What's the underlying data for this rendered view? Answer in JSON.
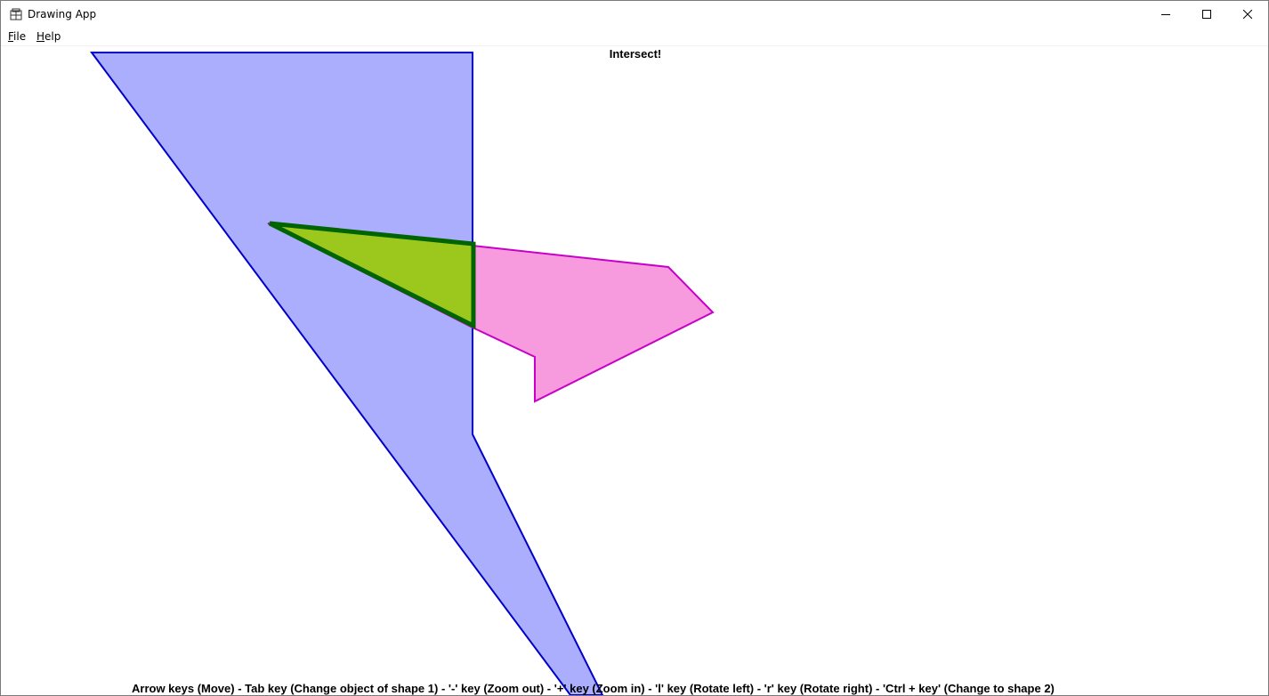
{
  "window": {
    "title": "Drawing App",
    "controls": {
      "minimize_icon": "minimize-icon",
      "maximize_icon": "maximize-icon",
      "close_icon": "close-icon"
    }
  },
  "menu": {
    "items": [
      {
        "mnemonic": "F",
        "rest": "ile"
      },
      {
        "mnemonic": "H",
        "rest": "elp"
      }
    ]
  },
  "canvas": {
    "status": "Intersect!",
    "help": "Arrow keys (Move)  -  Tab key (Change object of shape 1)  -  '-' key (Zoom out)  -  '+' key (Zoom in)  -  'l' key (Rotate left)  -  'r' key (Rotate right)  -  'Ctrl + key' (Change to shape 2)"
  },
  "colors": {
    "shape1_fill": "#aaaefd",
    "shape1_stroke": "#0000c8",
    "shape2_fill": "#f79ade",
    "shape2_stroke": "#c800c8",
    "intersection_fill": "#9cc81e",
    "intersection_stroke": "#006400"
  }
}
